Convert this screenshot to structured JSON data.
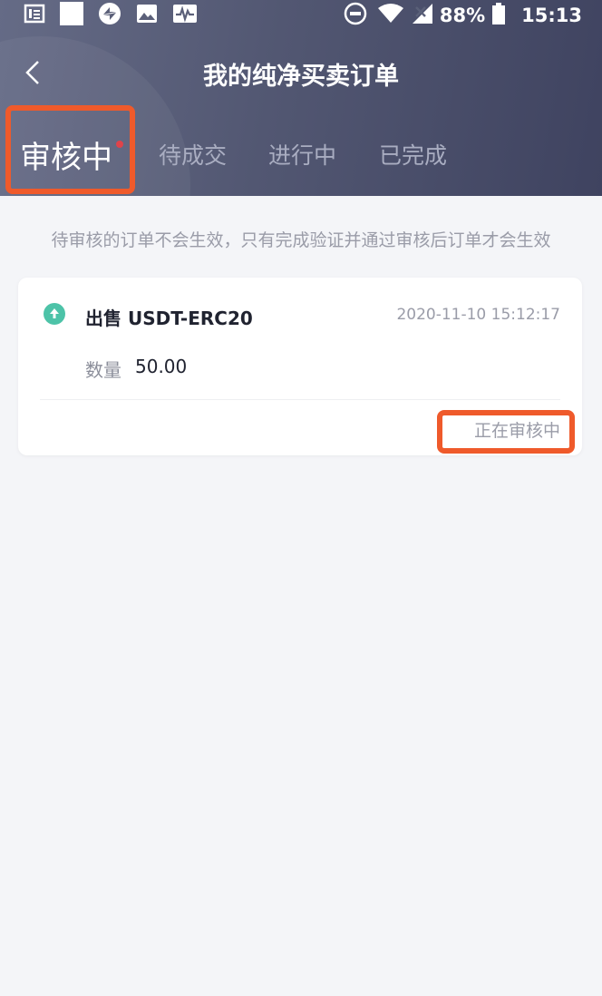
{
  "status_bar": {
    "battery": "88%",
    "time": "15:13",
    "left_icons": [
      "notes-icon",
      "square-icon",
      "sync-icon",
      "image-icon",
      "activity-icon"
    ],
    "right_icons": [
      "do-not-disturb-icon",
      "wifi-icon",
      "no-signal-icon",
      "battery-icon"
    ]
  },
  "header": {
    "title": "我的纯净买卖订单",
    "back_icon": "chevron-left-icon"
  },
  "tabs": [
    {
      "label": "审核中",
      "active": true,
      "has_dot": true
    },
    {
      "label": "待成交",
      "active": false
    },
    {
      "label": "进行中",
      "active": false
    },
    {
      "label": "已完成",
      "active": false
    }
  ],
  "notice": "待审核的订单不会生效，只有完成验证并通过审核后订单才会生效",
  "orders": [
    {
      "type_label": "出售 USDT-ERC20",
      "time": "2020-11-10 15:12:17",
      "quantity_label": "数量",
      "quantity": "50.00",
      "status": "正在审核中",
      "icon": "upload-arrow-icon"
    }
  ],
  "colors": {
    "header_bg": "#525772",
    "accent_highlight": "#ef5a2b",
    "red_dot": "#e0434a",
    "sell_icon": "#4dc3a8"
  }
}
